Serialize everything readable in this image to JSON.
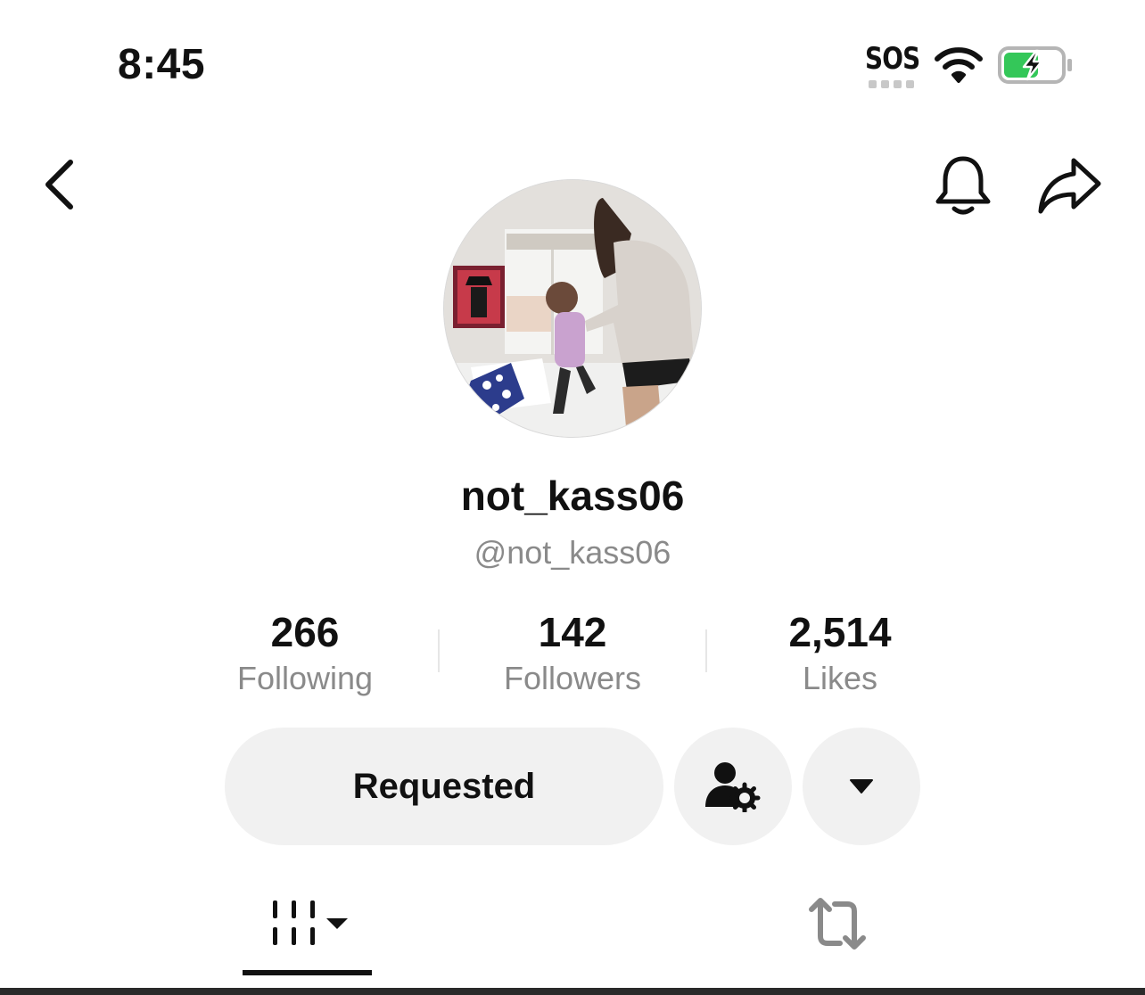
{
  "status_bar": {
    "time": "8:45",
    "carrier": "SOS",
    "wifi_icon": "wifi-icon",
    "battery_icon": "battery-charging-icon",
    "battery_color": "#34c759"
  },
  "nav": {
    "back_icon": "chevron-left-icon",
    "bell_icon": "bell-icon",
    "share_icon": "share-arrow-icon"
  },
  "profile": {
    "display_name": "not_kass06",
    "handle": "@not_kass06"
  },
  "stats": [
    {
      "value": "266",
      "label": "Following"
    },
    {
      "value": "142",
      "label": "Followers"
    },
    {
      "value": "2,514",
      "label": "Likes"
    }
  ],
  "actions": {
    "requested_label": "Requested",
    "friend_settings_icon": "person-gear-icon",
    "more_icon": "caret-down-icon"
  },
  "tabs": {
    "videos_icon": "grid-menu-icon",
    "reposts_icon": "repost-icon"
  },
  "colors": {
    "button_bg": "#f1f1f1",
    "secondary_text": "#8a8a8a",
    "primary_text": "#111111"
  }
}
